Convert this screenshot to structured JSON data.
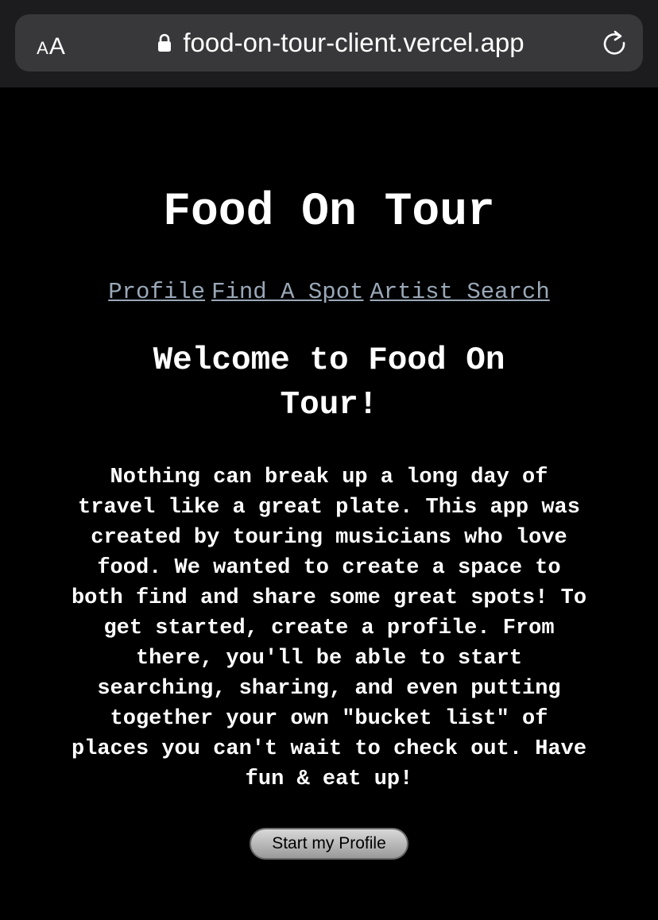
{
  "browser": {
    "text_size_small": "A",
    "text_size_large": "A",
    "url": "food-on-tour-client.vercel.app",
    "lock_icon": "lock-icon",
    "reload_icon": "reload-icon"
  },
  "page": {
    "title": "Food On Tour",
    "nav": [
      {
        "label": "Profile"
      },
      {
        "label": "Find A Spot"
      },
      {
        "label": "Artist Search"
      }
    ],
    "welcome_heading": "Welcome to Food On Tour!",
    "intro_text": "Nothing can break up a long day of travel like a great plate. This app was created by touring musicians who love food. We wanted to create a space to both find and share some great spots! To get started, create a profile. From there, you'll be able to start searching, sharing, and even putting together your own \"bucket list\" of places you can't wait to check out. Have fun & eat up!",
    "start_button": "Start my Profile"
  },
  "colors": {
    "background": "#000000",
    "browser_bar": "#1c1c1e",
    "url_pill": "#38383a",
    "nav_link": "#9aa8b8",
    "text": "#ffffff"
  }
}
